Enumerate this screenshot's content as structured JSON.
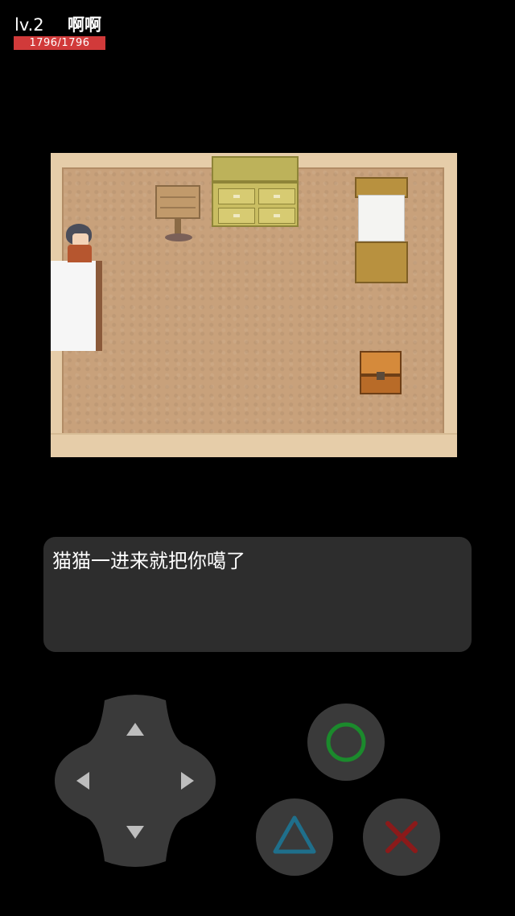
{
  "hud": {
    "level": "lv.2",
    "player_name": "啊啊",
    "hp_text": "1796/1796",
    "hp_fraction": 1.0,
    "hp_bar_color": "#d13a3a"
  },
  "map": {
    "scene": "bedroom",
    "objects": [
      "signpost",
      "dresser",
      "bed",
      "bed",
      "character",
      "treasure-chest"
    ]
  },
  "dialog": {
    "message": "猫猫一进来就把你噶了"
  },
  "controls": {
    "dpad_icons": [
      "arrow-up-icon",
      "arrow-down-icon",
      "arrow-left-icon",
      "arrow-right-icon"
    ],
    "circle_color": "#1b8a2c",
    "triangle_color": "#1f6f8b",
    "cross_color": "#8b1a1a"
  },
  "colors": {
    "background": "#000000",
    "dialog_bg": "#2d2d2d",
    "button_bg": "#3a3a3a"
  }
}
